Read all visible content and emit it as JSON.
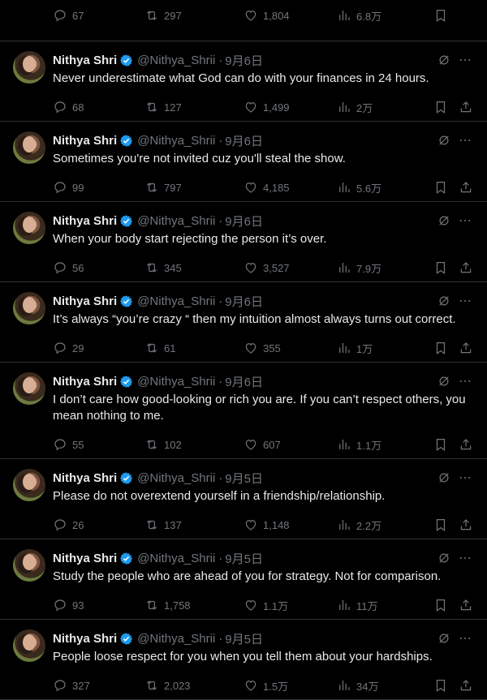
{
  "top_partial": {
    "replies": "67",
    "retweets": "297",
    "likes": "1,804",
    "views": "6.8万"
  },
  "tweets": [
    {
      "name": "Nithya Shri",
      "handle": "@Nithya_Shrii",
      "date": "9月6日",
      "text": "Never underestimate what God can do with your finances in 24 hours.",
      "replies": "68",
      "retweets": "127",
      "likes": "1,499",
      "views": "2万"
    },
    {
      "name": "Nithya Shri",
      "handle": "@Nithya_Shrii",
      "date": "9月6日",
      "text": "Sometimes you're not invited cuz you'll steal the show.",
      "replies": "99",
      "retweets": "797",
      "likes": "4,185",
      "views": "5.6万"
    },
    {
      "name": "Nithya Shri",
      "handle": "@Nithya_Shrii",
      "date": "9月6日",
      "text": "When your body start rejecting the person it’s over.",
      "replies": "56",
      "retweets": "345",
      "likes": "3,527",
      "views": "7.9万"
    },
    {
      "name": "Nithya Shri",
      "handle": "@Nithya_Shrii",
      "date": "9月6日",
      "text": "It’s always “you’re crazy “ then my intuition almost always turns out correct.",
      "replies": "29",
      "retweets": "61",
      "likes": "355",
      "views": "1万"
    },
    {
      "name": "Nithya Shri",
      "handle": "@Nithya_Shrii",
      "date": "9月6日",
      "text": "I don’t care how good-looking or rich you are. If you can’t respect others, you mean nothing to me.",
      "replies": "55",
      "retweets": "102",
      "likes": "607",
      "views": "1.1万"
    },
    {
      "name": "Nithya Shri",
      "handle": "@Nithya_Shrii",
      "date": "9月5日",
      "text": "Please do not overextend yourself in a friendship/relationship.",
      "replies": "26",
      "retweets": "137",
      "likes": "1,148",
      "views": "2.2万"
    },
    {
      "name": "Nithya Shri",
      "handle": "@Nithya_Shrii",
      "date": "9月5日",
      "text": "Study the people who are ahead of you for strategy. Not for comparison.",
      "replies": "93",
      "retweets": "1,758",
      "likes": "1.1万",
      "views": "11万"
    },
    {
      "name": "Nithya Shri",
      "handle": "@Nithya_Shrii",
      "date": "9月5日",
      "text": "People loose respect for you when you tell them about your hardships.",
      "replies": "327",
      "retweets": "2,023",
      "likes": "1.5万",
      "views": "34万"
    }
  ],
  "colors": {
    "background": "#000000",
    "text": "#e7e9ea",
    "muted": "#71767b",
    "border": "#2f3336",
    "verified": "#1d9bf0"
  },
  "icons": {
    "reply": "comment-bubble-icon",
    "retweet": "retweet-icon",
    "like": "heart-icon",
    "views": "views-chart-icon",
    "bookmark": "bookmark-icon",
    "share": "share-icon",
    "grok": "grok-icon",
    "more": "more-dots-icon",
    "verified": "verified-badge-icon"
  }
}
